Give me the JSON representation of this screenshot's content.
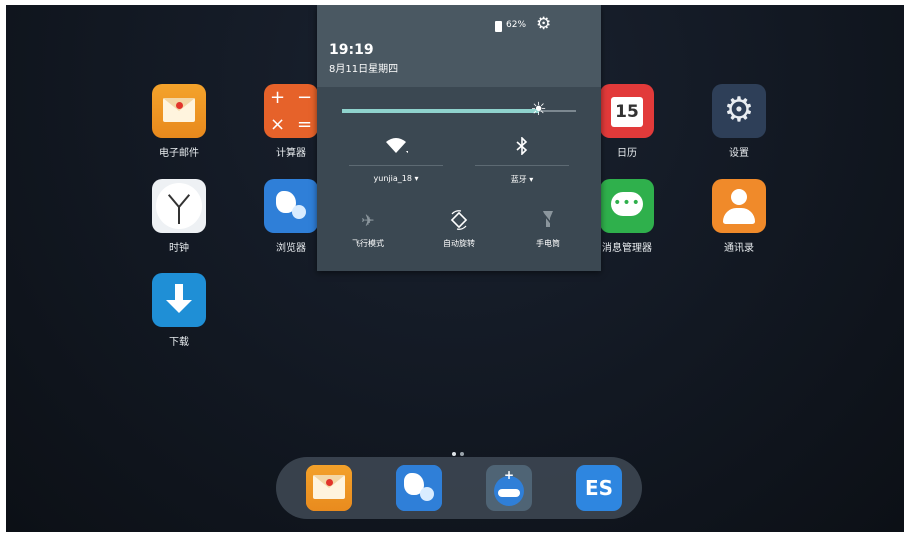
{
  "home": {
    "apps": [
      {
        "label": "电子邮件",
        "icon": "email-icon"
      },
      {
        "label": "计算器",
        "icon": "calculator-icon"
      },
      {
        "label": "日历",
        "icon": "calendar-icon",
        "day": "15"
      },
      {
        "label": "设置",
        "icon": "settings-icon"
      },
      {
        "label": "时钟",
        "icon": "clock-icon"
      },
      {
        "label": "浏览器",
        "icon": "browser-icon"
      },
      {
        "label": "消息管理器",
        "icon": "message-icon"
      },
      {
        "label": "通讯录",
        "icon": "contacts-icon"
      },
      {
        "label": "下载",
        "icon": "download-icon"
      }
    ],
    "page_count": 2,
    "active_page": 1
  },
  "dock": {
    "apps": [
      {
        "icon": "email-icon"
      },
      {
        "icon": "browser-icon"
      },
      {
        "icon": "app-market-icon"
      },
      {
        "icon": "es-file-explorer-icon",
        "glyph": "ES"
      }
    ]
  },
  "shade": {
    "battery": "62%",
    "time": "19:19",
    "date": "8月11日星期四",
    "brightness": 0.84,
    "wifi_label": "yunjia_18",
    "bluetooth_label": "蓝牙",
    "tiles": [
      {
        "label": "飞行模式",
        "icon": "airplane-mode-icon",
        "enabled": false
      },
      {
        "label": "自动旋转",
        "icon": "auto-rotate-icon",
        "enabled": true
      },
      {
        "label": "手电筒",
        "icon": "flashlight-icon",
        "enabled": false
      }
    ]
  },
  "colors": {
    "shade_bg": "#3b4852",
    "shade_header_bg": "#4a5862",
    "brightness_accent": "#8fd3cd"
  }
}
